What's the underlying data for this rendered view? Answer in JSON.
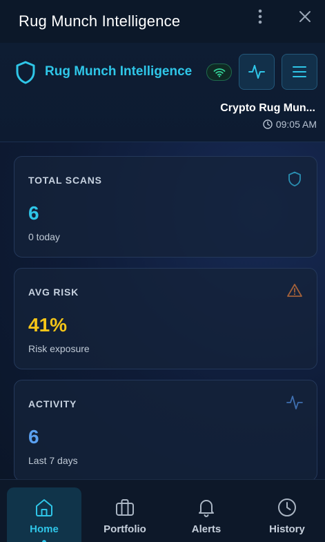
{
  "window": {
    "title": "Rug Munch Intelligence",
    "more_icon": "kebab-vertical-icon",
    "close_icon": "close-icon"
  },
  "header": {
    "brand_name": "Rug Munch Intelligence",
    "brand_icon": "shield-icon",
    "connection_icon": "wifi-icon",
    "activity_button_icon": "pulse-icon",
    "menu_button_icon": "hamburger-icon",
    "account_name": "Crypto Rug Mun...",
    "time": "09:05 AM",
    "time_icon": "clock-icon"
  },
  "stats": [
    {
      "label": "TOTAL SCANS",
      "value": "6",
      "sub": "0 today",
      "icon": "shield-icon",
      "color": "#2fc6e8"
    },
    {
      "label": "AVG RISK",
      "value": "41%",
      "sub": "Risk exposure",
      "icon": "warning-icon",
      "color": "#f5c518"
    },
    {
      "label": "ACTIVITY",
      "value": "6",
      "sub": "Last 7 days",
      "icon": "pulse-icon",
      "color": "#5aa0f0"
    }
  ],
  "nav": {
    "items": [
      {
        "label": "Home",
        "icon": "home-icon",
        "active": true
      },
      {
        "label": "Portfolio",
        "icon": "briefcase-icon",
        "active": false
      },
      {
        "label": "Alerts",
        "icon": "bell-icon",
        "active": false
      },
      {
        "label": "History",
        "icon": "clock-icon",
        "active": false
      }
    ]
  },
  "colors": {
    "accent": "#2fc6e8",
    "warning": "#f5c518",
    "info": "#5aa0f0",
    "online": "#34d399"
  }
}
